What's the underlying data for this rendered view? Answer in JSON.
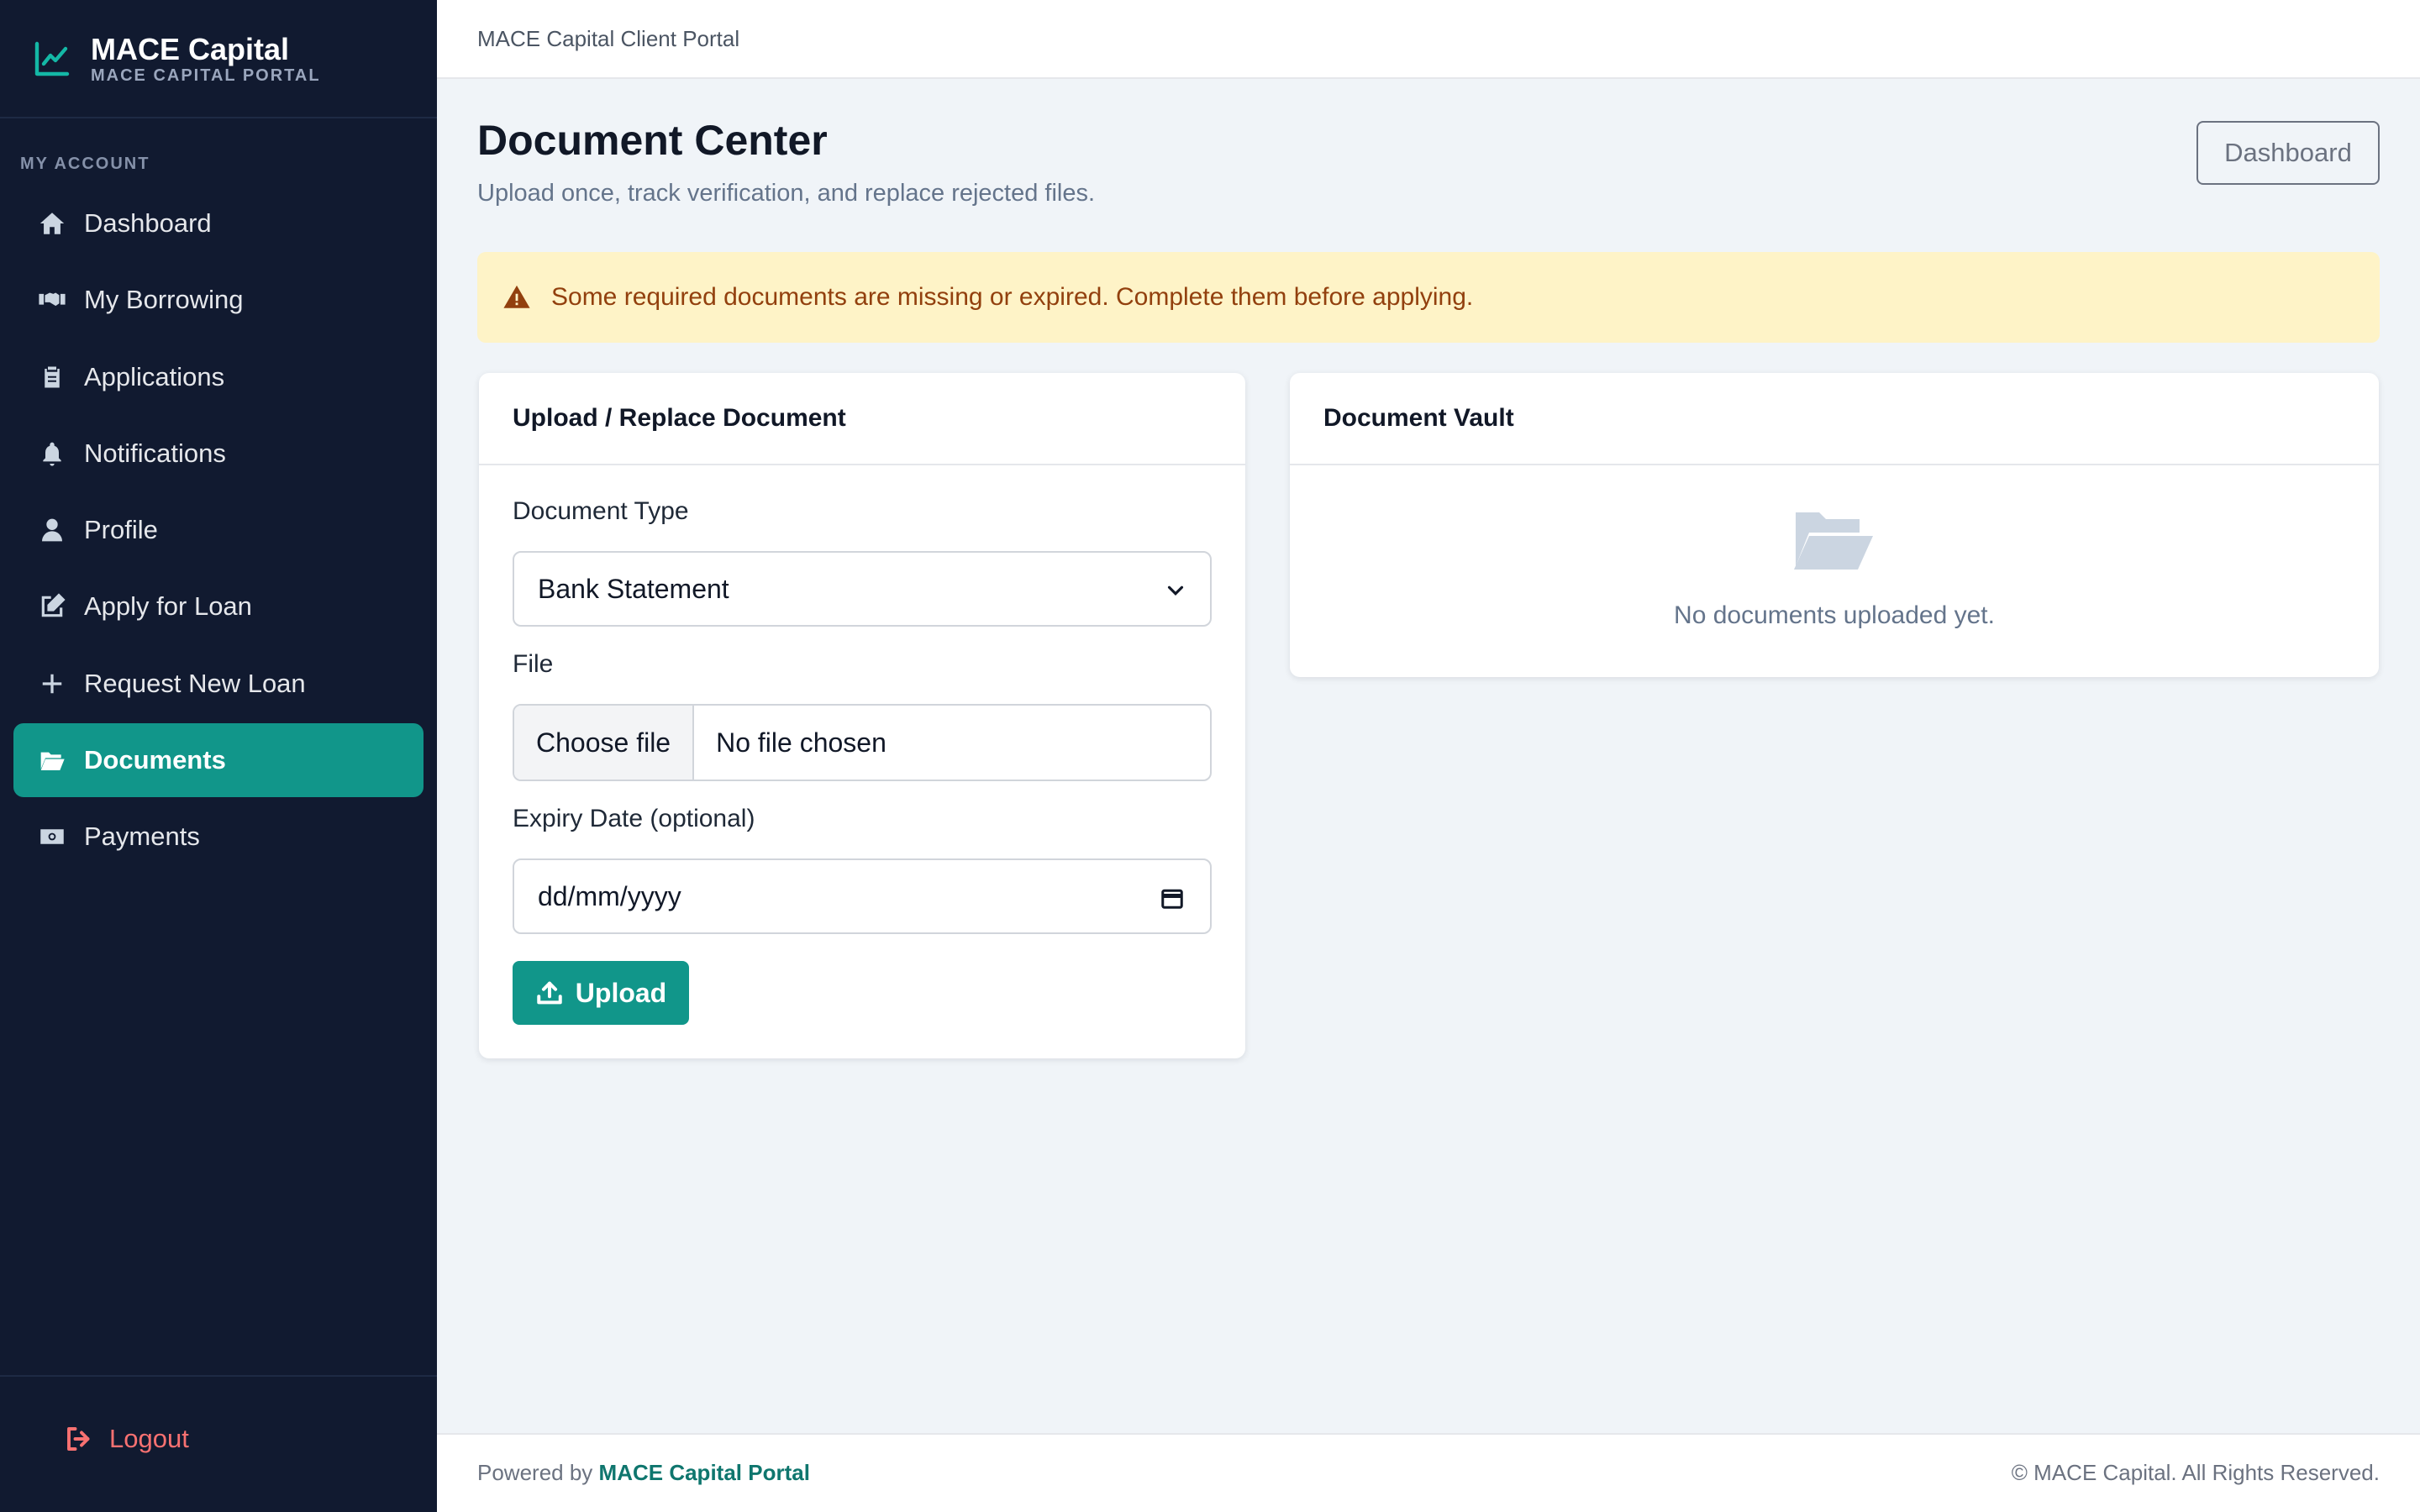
{
  "brand": {
    "title": "MACE Capital",
    "subtitle": "MACE CAPITAL PORTAL"
  },
  "sidebar": {
    "section_label": "MY ACCOUNT",
    "items": [
      {
        "label": "Dashboard",
        "icon": "home-icon"
      },
      {
        "label": "My Borrowing",
        "icon": "handshake-icon"
      },
      {
        "label": "Applications",
        "icon": "clipboard-icon"
      },
      {
        "label": "Notifications",
        "icon": "bell-icon"
      },
      {
        "label": "Profile",
        "icon": "user-icon"
      },
      {
        "label": "Apply for Loan",
        "icon": "edit-icon"
      },
      {
        "label": "Request New Loan",
        "icon": "plus-icon"
      },
      {
        "label": "Documents",
        "icon": "folder-open-icon",
        "active": true
      },
      {
        "label": "Payments",
        "icon": "money-icon"
      }
    ],
    "logout_label": "Logout"
  },
  "topbar": {
    "title": "MACE Capital Client Portal"
  },
  "page": {
    "title": "Document Center",
    "subtitle": "Upload once, track verification, and replace rejected files.",
    "dashboard_button": "Dashboard"
  },
  "alert": {
    "text": "Some required documents are missing or expired. Complete them before applying."
  },
  "upload_card": {
    "header": "Upload / Replace Document",
    "document_type_label": "Document Type",
    "document_type_value": "Bank Statement",
    "file_label": "File",
    "file_button": "Choose file",
    "file_status": "No file chosen",
    "expiry_label": "Expiry Date (optional)",
    "expiry_placeholder": "dd/mm/yyyy",
    "upload_button": "Upload"
  },
  "vault_card": {
    "header": "Document Vault",
    "empty_text": "No documents uploaded yet."
  },
  "footer": {
    "powered_prefix": "Powered by",
    "powered_name": "MACE Capital Portal",
    "copyright": "© MACE Capital. All Rights Reserved."
  },
  "colors": {
    "sidebar_bg": "#111a30",
    "accent": "#11968a",
    "alert_bg": "#fef3c7",
    "alert_text": "#92400e",
    "logout": "#f87171"
  }
}
